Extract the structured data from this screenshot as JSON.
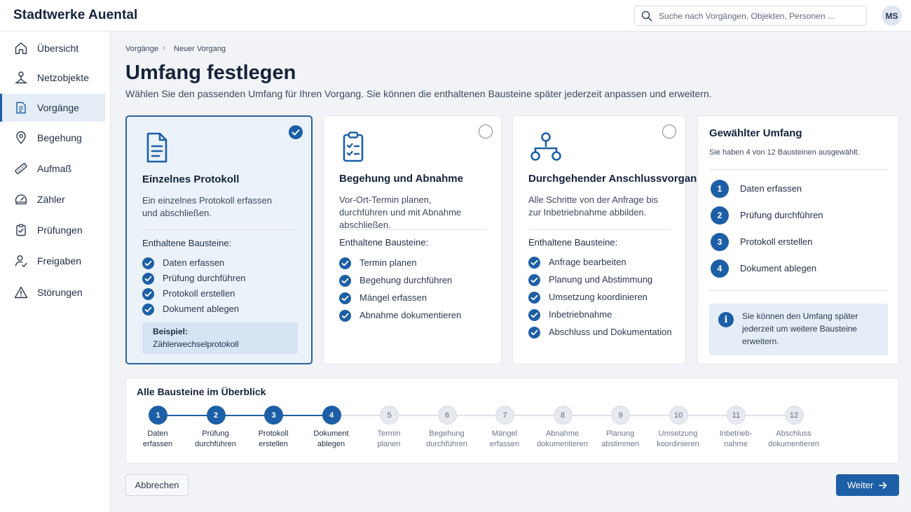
{
  "app": {
    "title": "Stadtwerke Auental"
  },
  "search": {
    "placeholder": "Suche nach Vorgängen, Objekten, Personen ..."
  },
  "user": {
    "initials": "MS"
  },
  "sidebar": {
    "items": [
      {
        "label": "Übersicht",
        "icon": "home-icon"
      },
      {
        "label": "Netzobjekte",
        "icon": "network-object-icon"
      },
      {
        "label": "Vorgänge",
        "icon": "document-icon",
        "active": true
      },
      {
        "label": "Begehung",
        "icon": "location-pin-icon"
      },
      {
        "label": "Aufmaß",
        "icon": "ruler-icon"
      },
      {
        "label": "Zähler",
        "icon": "meter-gauge-icon"
      },
      {
        "label": "Prüfungen",
        "icon": "clipboard-check-icon"
      },
      {
        "label": "Freigaben",
        "icon": "user-check-icon"
      },
      {
        "label": "Störungen",
        "icon": "warning-triangle-icon"
      }
    ]
  },
  "breadcrumb": {
    "parent": "Vorgänge",
    "separator": "›",
    "current": "Neuer Vorgang"
  },
  "page": {
    "title": "Umfang festlegen",
    "subtitle": "Wählen Sie den passenden Umfang für Ihren Vorgang. Sie können die enthaltenen Bausteine später jederzeit anpassen und erweitern."
  },
  "cards": [
    {
      "title": "Einzelnes Protokoll",
      "description": "Ein einzelnes Protokoll erfassen und abschließen.",
      "contains_label": "Enthaltene Bausteine:",
      "items": [
        "Daten erfassen",
        "Prüfung durchführen",
        "Protokoll erstellen",
        "Dokument ablegen"
      ],
      "example_label": "Beispiel:",
      "example_value": "Zählerwechselprotokoll",
      "selected": true,
      "icon": "document-icon"
    },
    {
      "title": "Begehung und Abnahme",
      "description": "Vor-Ort-Termin planen, durchführen und mit Abnahme abschließen.",
      "contains_label": "Enthaltene Bausteine:",
      "items": [
        "Termin planen",
        "Begehung durchführen",
        "Mängel erfassen",
        "Abnahme dokumentieren"
      ],
      "selected": false,
      "icon": "clipboard-check-icon"
    },
    {
      "title": "Durchgehender Anschlussvorgang",
      "description": "Alle Schritte von der Anfrage bis zur Inbetriebnahme abbilden.",
      "contains_label": "Enthaltene Bausteine:",
      "items": [
        "Anfrage bearbeiten",
        "Planung und Abstimmung",
        "Umsetzung koordinieren",
        "Inbetriebnahme",
        "Abschluss und Dokumentation"
      ],
      "selected": false,
      "icon": "workflow-icon"
    }
  ],
  "summary": {
    "title": "Gewählter Umfang",
    "count_text": "Sie haben 4 von 12 Bausteinen ausgewählt.",
    "steps": [
      {
        "num": "1",
        "label": "Daten erfassen"
      },
      {
        "num": "2",
        "label": "Prüfung durchführen"
      },
      {
        "num": "3",
        "label": "Protokoll erstellen"
      },
      {
        "num": "4",
        "label": "Dokument ablegen"
      }
    ],
    "info_text": "Sie können den Umfang später jederzeit um weitere Bausteine erweitern."
  },
  "overview": {
    "title": "Alle Bausteine im Überblick",
    "steps": [
      {
        "num": "1",
        "label": "Daten\nerfassen",
        "active": true
      },
      {
        "num": "2",
        "label": "Prüfung\ndurchführen",
        "active": true
      },
      {
        "num": "3",
        "label": "Protokoll\nerstellen",
        "active": true
      },
      {
        "num": "4",
        "label": "Dokument\nablegen",
        "active": true
      },
      {
        "num": "5",
        "label": "Termin\nplanen",
        "active": false
      },
      {
        "num": "6",
        "label": "Begehung\ndurchführen",
        "active": false
      },
      {
        "num": "7",
        "label": "Mängel\nerfassen",
        "active": false
      },
      {
        "num": "8",
        "label": "Abnahme\ndokumentieren",
        "active": false
      },
      {
        "num": "9",
        "label": "Planung\nabstimmen",
        "active": false
      },
      {
        "num": "10",
        "label": "Umsetzung\nkoordinieren",
        "active": false
      },
      {
        "num": "11",
        "label": "Inbetrieb-\nnahme",
        "active": false
      },
      {
        "num": "12",
        "label": "Abschluss\ndokumentieren",
        "active": false
      }
    ]
  },
  "actions": {
    "cancel_label": "Abbrechen",
    "next_label": "Weiter"
  },
  "colors": {
    "accent": "#1d5fa6",
    "selected_bg": "#ebf2fa",
    "background": "#f1f3f6"
  }
}
